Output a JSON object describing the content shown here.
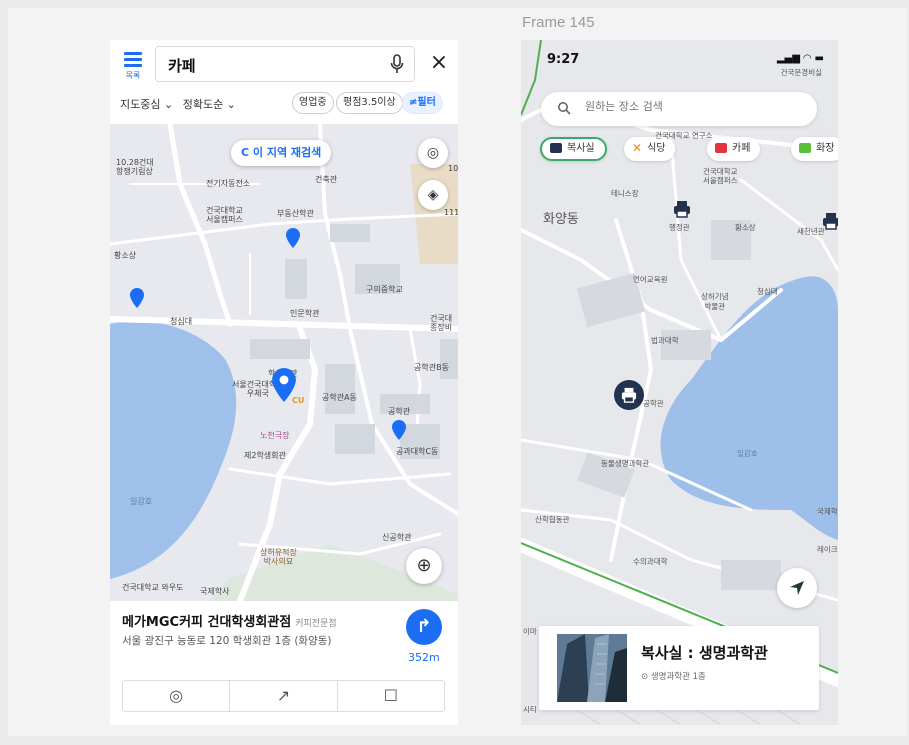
{
  "frame_label": "Frame 145",
  "left_app": {
    "list_label": "목록",
    "search_value": "카페",
    "options": [
      "지도중심 ⌄",
      "정확도순 ⌄"
    ],
    "chips": [
      "영업중",
      "평점3.5이상",
      "≠필터"
    ],
    "rescan_label": "C 이 지역 재검색",
    "map_labels": {
      "l1": "10.28건대\n항쟁기림상",
      "l2": "전기자동전소",
      "l3": "건축관",
      "l4": "건국대학교\n서울캠퍼스",
      "l5": "부동산학관",
      "l6": "황소상",
      "l7": "구의중학교",
      "l8": "인문학관",
      "l9": "청심대",
      "l10": "건국대\n종장비",
      "l11": "학생회관",
      "l12": "공학관B동",
      "l13": "서울건국대학교\n우체국",
      "l14": "CU",
      "l15": "공학관A동",
      "l16": "공학관",
      "l17": "노천극장",
      "l18": "제2학생회관",
      "l19": "공과대학C동",
      "l20": "일감호",
      "l21": "상허유적장\n박사의묘",
      "l22": "신공학관",
      "l23": "건국대학교 와우도",
      "l24": "국제학사",
      "l25": "10",
      "l26": "111"
    },
    "place": {
      "name": "메가MGC커피 건대학생회관점",
      "category": "커피전문점",
      "address": "서울 광진구 능동로 120 학생회관 1층 (화양동)",
      "distance": "352m"
    }
  },
  "right_app": {
    "time": "9:27",
    "status_sub": "건국문경비실",
    "search_placeholder": "원하는 장소 검색",
    "categories": [
      "복사실",
      "식당",
      "카페",
      "화장"
    ],
    "map_labels": {
      "b1": "화양동",
      "b2": "테니스장",
      "b3": "건국대학교\n서울캠퍼스",
      "b4": "행정관",
      "b5": "황소상",
      "b6": "새천년관",
      "b7": "언어교육원",
      "b8": "상허기념\n박물관",
      "b9": "청심대",
      "b10": "법과대학",
      "b11": "일감호",
      "b12": "동물생명과학관",
      "b13": "산학협동관",
      "b14": "수의과대학",
      "b15": "국제학",
      "b16": "레이크",
      "b17": "이마",
      "b18": "시티",
      "b19": "공학관",
      "b20": "건국대학교 연구소"
    },
    "place": {
      "title": "복사실 : 생명과학관",
      "sub": "생명과학관 1층"
    }
  }
}
